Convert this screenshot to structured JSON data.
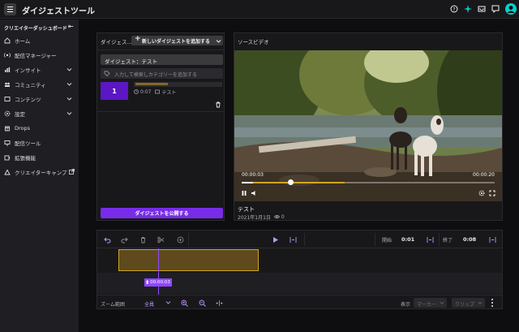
{
  "app": {
    "title": "ダイジェストツール"
  },
  "sidebar": {
    "header": "クリエイターダッシュボード",
    "items": [
      {
        "label": "ホーム",
        "icon": "home-icon"
      },
      {
        "label": "配信マネージャー",
        "icon": "broadcast-icon"
      },
      {
        "label": "インサイト",
        "icon": "insights-icon",
        "expandable": true
      },
      {
        "label": "コミュニティ",
        "icon": "community-icon",
        "expandable": true
      },
      {
        "label": "コンテンツ",
        "icon": "content-icon",
        "expandable": true
      },
      {
        "label": "設定",
        "icon": "settings-icon",
        "expandable": true
      },
      {
        "label": "Drops",
        "icon": "drops-icon"
      },
      {
        "label": "配信ツール",
        "icon": "stream-tools-icon"
      },
      {
        "label": "拡張機能",
        "icon": "extensions-icon"
      },
      {
        "label": "クリエイターキャンプ",
        "icon": "external-link-icon"
      }
    ]
  },
  "digest_panel": {
    "title": "ダイジェス...",
    "add_button": "新しいダイジェストを追加する",
    "digest_name": "ダイジェスト：テスト",
    "category_placeholder": "入力して検索しカテゴリーを追加する",
    "clip": {
      "number": "1",
      "duration": "0:07",
      "name": "テスト"
    },
    "publish_button": "ダイジェストを公開する"
  },
  "source_panel": {
    "title": "ソースビデオ",
    "current_time": "00:00:03",
    "total_time": "00:00:20",
    "progress": 0.15,
    "video_title": "テスト",
    "video_date": "2021年1月1日",
    "views": "0"
  },
  "timeline": {
    "start_label": "開始",
    "start_value": "0:01",
    "end_label": "終了",
    "end_value": "0:08",
    "playhead_time": "00:00:03",
    "zoom_label": "ズーム範囲",
    "zoom_value": "全員",
    "display_label": "表示",
    "marker_dropdown": "マーカー",
    "clip_dropdown": "クリップ"
  },
  "colors": {
    "accent": "#9147ff",
    "segment": "#d0a620",
    "background": "#0e0e10"
  }
}
